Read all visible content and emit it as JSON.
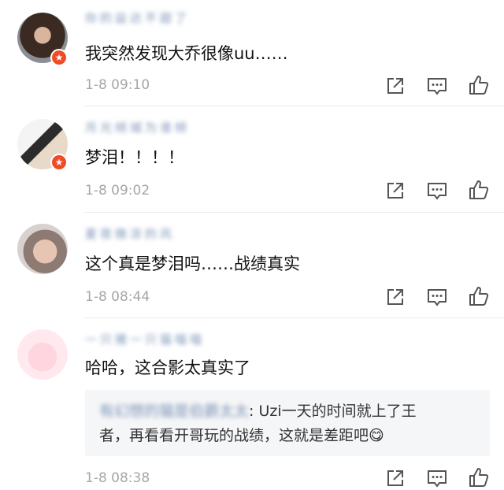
{
  "comments": [
    {
      "name": "你的益达不甜了",
      "text": "我突然发现大乔很像uu……",
      "time": "1-8 09:10"
    },
    {
      "name": "月光倾城为谁倾",
      "text": "梦泪！！！！",
      "time": "1-8 09:02"
    },
    {
      "name": "夏夜微凉的风",
      "text": "这个真是梦泪吗……战绩真实",
      "time": "1-8 08:44"
    },
    {
      "name": "一只猪一只猫喵喵",
      "text": "哈哈，这合影太真实了",
      "time": "1-8 08:38",
      "quote": {
        "author": "有幻想的猫是伯爵太太",
        "line1_rest": ": Uzi一天的时间就上了王",
        "line2": "者，再看看开哥玩的战绩，这就是差距吧",
        "emoji": "😋"
      }
    }
  ],
  "icons": {
    "share": "share-icon",
    "comment": "comment-icon",
    "like": "like-icon"
  },
  "colors": {
    "badge": "#f04b25",
    "name": "#7b93b6",
    "time": "#a6a6a6"
  }
}
